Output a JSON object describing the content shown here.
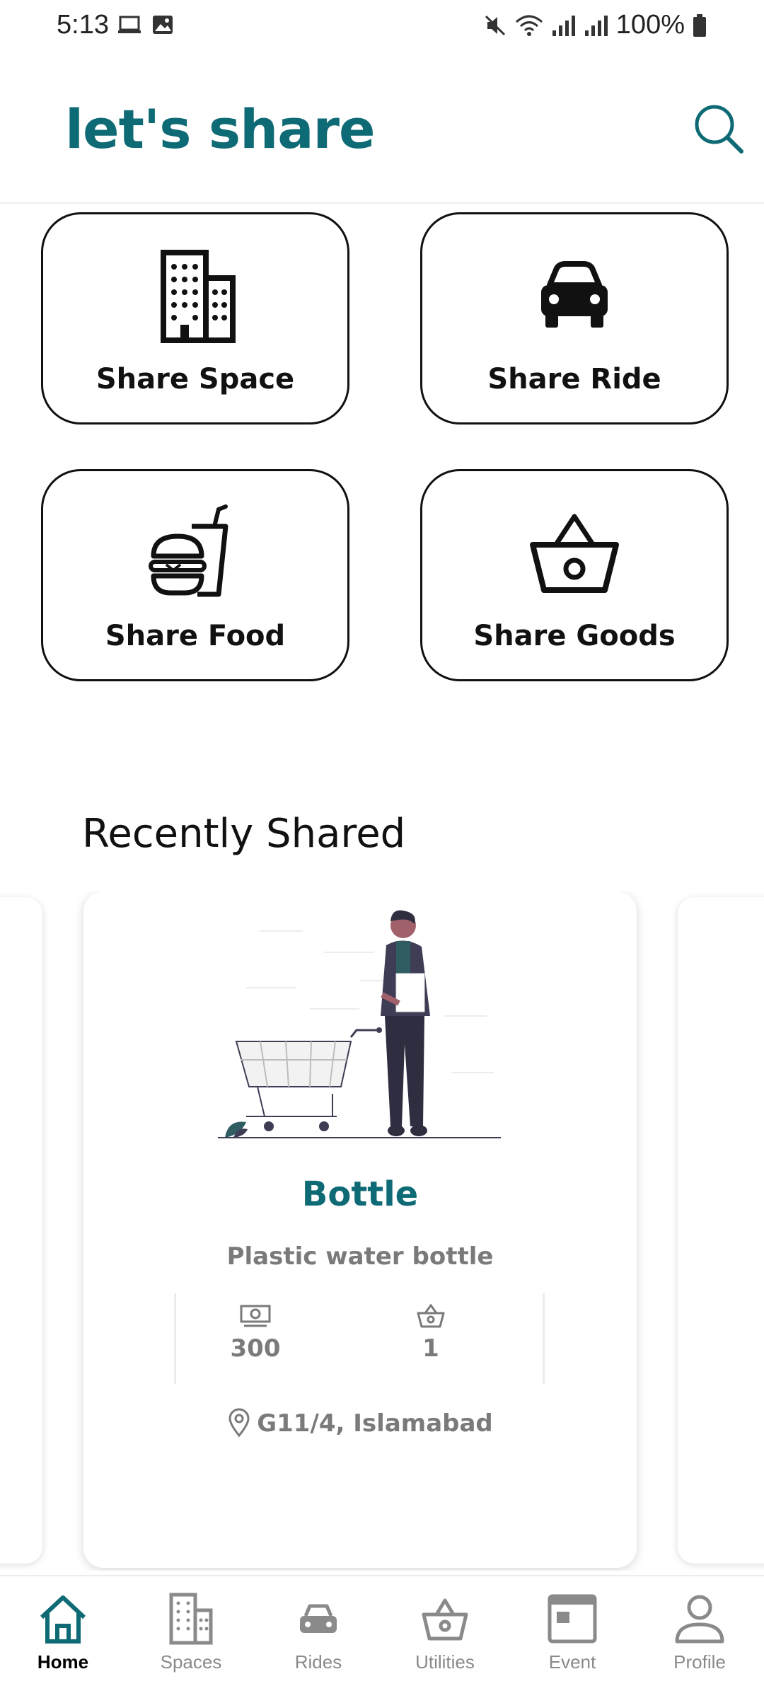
{
  "status_bar": {
    "time": "5:13",
    "battery": "100%"
  },
  "header": {
    "title": "let's share",
    "search_icon": "search-icon"
  },
  "categories": [
    {
      "label": "Share Space",
      "icon": "building-icon"
    },
    {
      "label": "Share Ride",
      "icon": "car-icon"
    },
    {
      "label": "Share Food",
      "icon": "food-icon"
    },
    {
      "label": "Share Goods",
      "icon": "basket-icon"
    }
  ],
  "recent": {
    "title": "Recently Shared",
    "items": [
      {
        "title": "Bottle",
        "description": "Plastic water bottle",
        "price": "300",
        "quantity": "1",
        "location": "G11/4, Islamabad"
      }
    ]
  },
  "bottom_nav": {
    "items": [
      {
        "label": "Home",
        "icon": "home-icon",
        "active": true
      },
      {
        "label": "Spaces",
        "icon": "building-icon"
      },
      {
        "label": "Rides",
        "icon": "car-icon"
      },
      {
        "label": "Utilities",
        "icon": "basket-icon"
      },
      {
        "label": "Event",
        "icon": "calendar-icon"
      },
      {
        "label": "Profile",
        "icon": "person-icon"
      }
    ]
  },
  "colors": {
    "brand": "#0e6a74",
    "muted_text": "#7a7a7a",
    "nav_inactive": "#8a8a8a"
  }
}
